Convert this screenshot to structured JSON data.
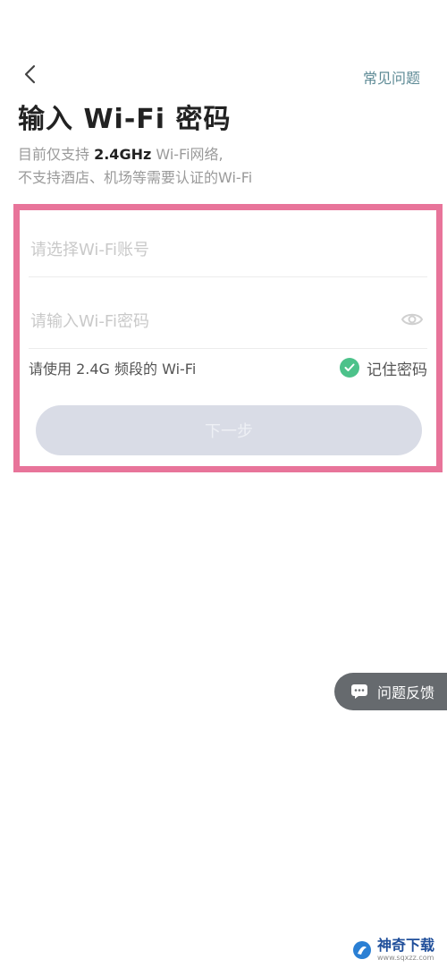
{
  "header": {
    "faq_label": "常见问题"
  },
  "title": "输入 Wi-Fi 密码",
  "subtitle": {
    "line1_prefix": "目前仅支持 ",
    "line1_highlight": "2.4GHz",
    "line1_suffix": " Wi-Fi网络,",
    "line2": "不支持酒店、机场等需要认证的Wi-Fi"
  },
  "form": {
    "ssid_placeholder": "请选择Wi-Fi账号",
    "ssid_value": "",
    "password_placeholder": "请输入Wi-Fi密码",
    "password_value": "",
    "hint_text": "请使用 2.4G 频段的 Wi-Fi",
    "remember_label": "记住密码",
    "remember_checked": true,
    "next_label": "下一步"
  },
  "feedback": {
    "label": "问题反馈"
  },
  "watermark": {
    "title": "神奇下载",
    "url": "www.sqxzz.com"
  },
  "colors": {
    "accent_green": "#4cc28a",
    "highlight_border": "#e8749a",
    "disabled_button": "#d9dce6",
    "faq_link": "#5d8a95"
  },
  "icons": [
    "back-arrow-icon",
    "eye-icon",
    "check-icon",
    "message-icon",
    "logo-icon"
  ]
}
